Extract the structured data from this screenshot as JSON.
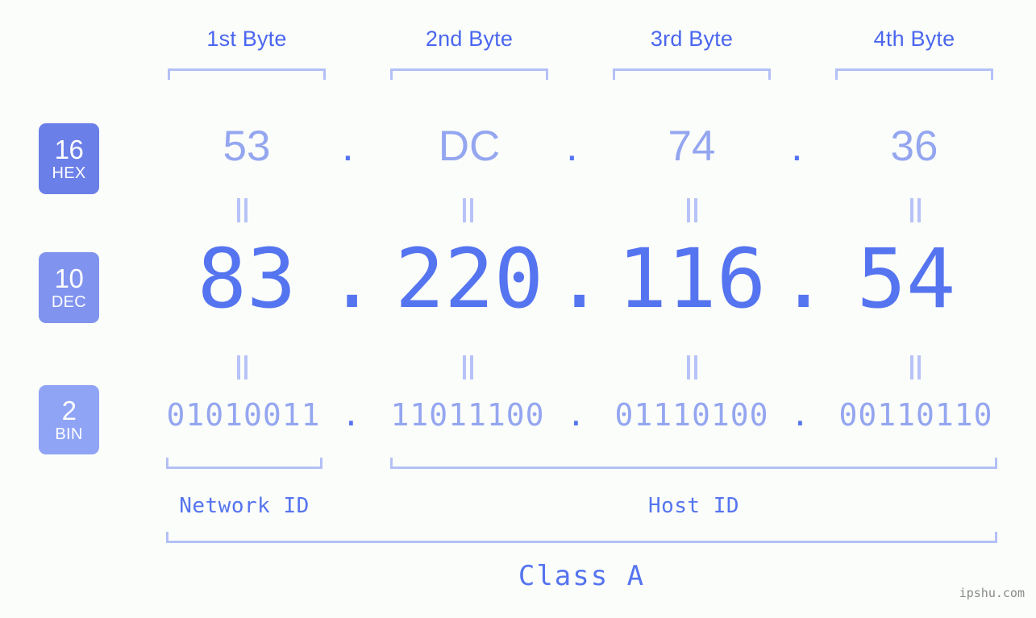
{
  "theme": {
    "background": "#fbfdfa",
    "accent_strong": "#5574f0",
    "accent_light": "#94a6f0",
    "bracket": "#b3c0f7",
    "badge_hex": "#6b7fe8",
    "badge_dec": "#8093ef",
    "badge_bin": "#8fa4f5",
    "watermark": "#8a8a8a"
  },
  "header": {
    "byte_labels": [
      "1st Byte",
      "2nd Byte",
      "3rd Byte",
      "4th Byte"
    ]
  },
  "bases": [
    {
      "number": "16",
      "name": "HEX"
    },
    {
      "number": "10",
      "name": "DEC"
    },
    {
      "number": "2",
      "name": "BIN"
    }
  ],
  "separator": ".",
  "rows": {
    "hex": {
      "base": "16",
      "label": "HEX",
      "octets": [
        "53",
        "DC",
        "74",
        "36"
      ]
    },
    "dec": {
      "base": "10",
      "label": "DEC",
      "octets": [
        "83",
        "220",
        "116",
        "54"
      ]
    },
    "bin": {
      "base": "2",
      "label": "BIN",
      "octets": [
        "01010011",
        "11011100",
        "01110100",
        "00110110"
      ]
    }
  },
  "ip": {
    "hex": "53.DC.74.36",
    "dec": "83.220.116.54",
    "bin": "01010011.11011100.01110100.00110110"
  },
  "partition": {
    "network_id_label": "Network ID",
    "host_id_label": "Host ID",
    "class_label": "Class A"
  },
  "watermark": "ipshu.com"
}
